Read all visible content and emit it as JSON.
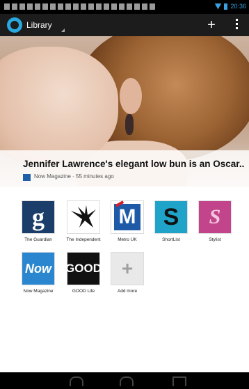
{
  "status_bar": {
    "time": "20:36"
  },
  "action_bar": {
    "title": "Library"
  },
  "hero": {
    "headline": "Jennifer Lawrence's elegant low bun is an Oscar...",
    "source": "Now Magazine",
    "separator": " - ",
    "time_ago": "55 minutes ago"
  },
  "sources": [
    {
      "label": "The Guardian",
      "logo_text": "g",
      "icon": "guardian-logo"
    },
    {
      "label": "The Independent",
      "logo_text": "",
      "icon": "eagle-logo"
    },
    {
      "label": "Metro UK",
      "logo_text": "M",
      "icon": "metro-logo"
    },
    {
      "label": "ShortList",
      "logo_text": "S",
      "icon": "shortlist-logo"
    },
    {
      "label": "Stylist",
      "logo_text": "S",
      "icon": "stylist-logo"
    },
    {
      "label": "Now Magazine",
      "logo_text": "Now",
      "icon": "now-logo"
    },
    {
      "label": "GOOD Life",
      "logo_text": "GOOD",
      "icon": "good-logo"
    },
    {
      "label": "Add more",
      "logo_text": "+",
      "icon": "plus-icon"
    }
  ],
  "colors": {
    "accent": "#29a8e0",
    "action_bar": "#1c1c1c"
  }
}
